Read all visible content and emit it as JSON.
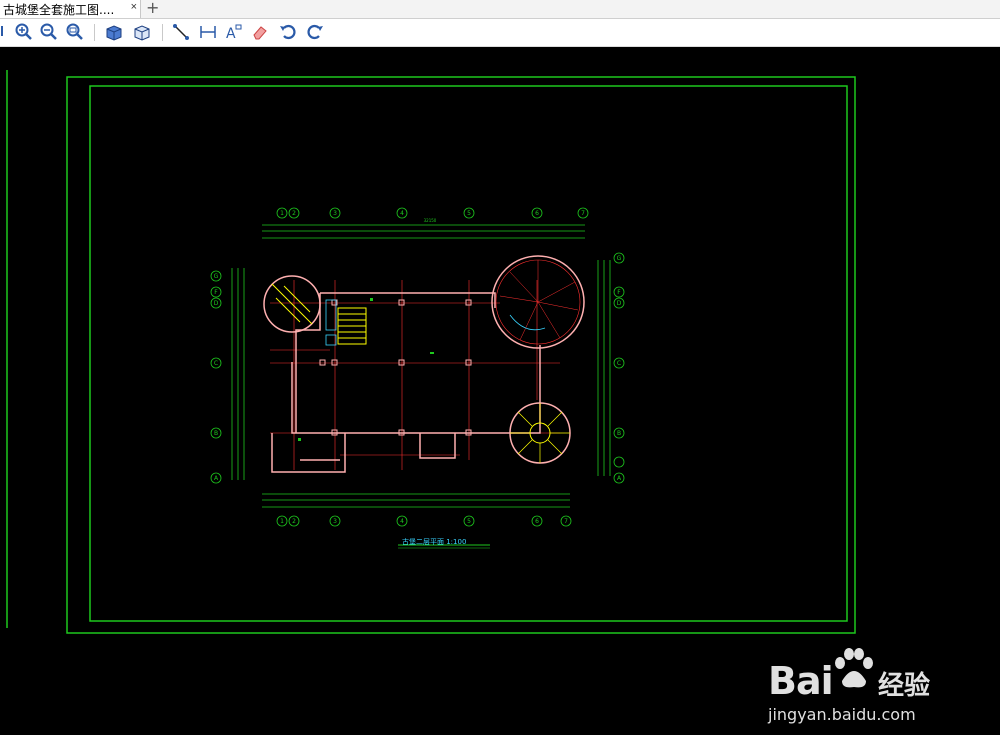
{
  "tab": {
    "title": "古城堡全套施工图....",
    "close_glyph": "×",
    "add_glyph": "+"
  },
  "toolbar": {
    "tools": [
      "pan-icon",
      "zoom-in-icon",
      "zoom-out-icon",
      "zoom-window-icon",
      "view-3d-icon",
      "view-box-icon",
      "line-icon",
      "dimension-icon",
      "text-icon",
      "eraser-icon",
      "undo-icon",
      "redo-icon"
    ]
  },
  "drawing": {
    "grid_top": [
      "1",
      "2",
      "3",
      "4",
      "5",
      "6",
      "7"
    ],
    "grid_left": [
      "G",
      "F",
      "D",
      "C",
      "B",
      "A"
    ],
    "overall_dim": "32150",
    "plan_title": "古堡二层平面 1:100",
    "colors": {
      "frame": "#1ec81e",
      "walls": "#ff3030",
      "outline": "#ffffff",
      "dims": "#1ec81e",
      "stair": "#ffff00"
    }
  },
  "watermark": {
    "brand": "Bai",
    "brand2": "经验",
    "url": "jingyan.baidu.com"
  }
}
